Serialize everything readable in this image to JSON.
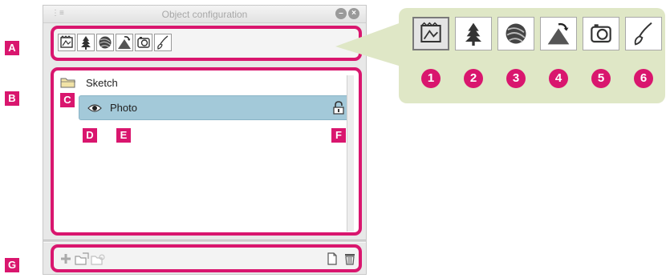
{
  "panel": {
    "title": "Object configuration",
    "menu_icon": "menu-icon",
    "minimize_icon": "minimize-icon",
    "close_icon": "close-icon"
  },
  "toolbar": {
    "buttons": [
      {
        "icon": "frame-icon"
      },
      {
        "icon": "tree-icon"
      },
      {
        "icon": "sphere-icon"
      },
      {
        "icon": "perspective-icon"
      },
      {
        "icon": "camera-icon"
      },
      {
        "icon": "brush-icon"
      }
    ]
  },
  "tree": {
    "folder": {
      "label": "Sketch",
      "icon": "folder-icon"
    },
    "item": {
      "label": "Photo",
      "icon": "eye-icon",
      "lock_icon": "lock-icon"
    }
  },
  "bottombar": {
    "icons": [
      "add-icon",
      "new-folder-icon",
      "folder-group-icon",
      "new-page-icon",
      "trash-icon"
    ]
  },
  "callout": {
    "numbers": [
      "1",
      "2",
      "3",
      "4",
      "5",
      "6"
    ]
  },
  "markers": [
    "A",
    "B",
    "C",
    "D",
    "E",
    "F",
    "G"
  ],
  "colors": {
    "accent": "#d9166e",
    "selection": "#a3c9d9",
    "callout_bg": "#dfe7c6"
  }
}
